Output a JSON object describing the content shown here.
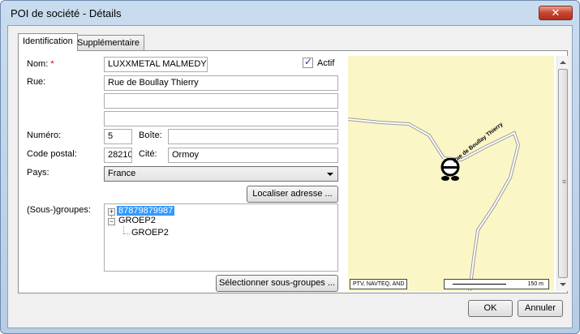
{
  "window": {
    "title": "POI de société - Détails",
    "close_glyph": "✕"
  },
  "tabs": [
    {
      "label": "Identification",
      "active": true
    },
    {
      "label": "Supplémentaire",
      "active": false
    }
  ],
  "form": {
    "name_label": "Nom:",
    "required_marker": "*",
    "name_value": "LUXXMETAL MALMEDY",
    "active_label": "Actif",
    "active_checked": true,
    "street_label": "Rue:",
    "street_value": "Rue de Boullay Thierry",
    "street2_value": "",
    "street3_value": "",
    "number_label": "Numéro:",
    "number_value": "5",
    "box_label": "Boîte:",
    "box_value": "",
    "postal_label": "Code postal:",
    "postal_value": "28210",
    "city_label": "Cité:",
    "city_value": "Ormoy",
    "country_label": "Pays:",
    "country_value": "France",
    "locate_button": "Localiser adresse ...",
    "groups_label": "(Sous-)groupes:",
    "select_groups_button": "Sélectionner sous-groupes ..."
  },
  "tree": {
    "nodes": [
      {
        "label": "87879879987",
        "expander": "+",
        "selected": true
      },
      {
        "label": "GROEP2",
        "expander": "−",
        "selected": false
      },
      {
        "label": "GROEP2",
        "expander": "",
        "selected": false
      }
    ]
  },
  "map": {
    "road_label": "Rue de Boullay Thierry",
    "copyright": "PTV, NAVTEQ, AND",
    "scale_label": "150 m",
    "background_color": "#fbf6c6"
  },
  "footer": {
    "ok_button": "OK",
    "cancel_button": "Annuler"
  }
}
